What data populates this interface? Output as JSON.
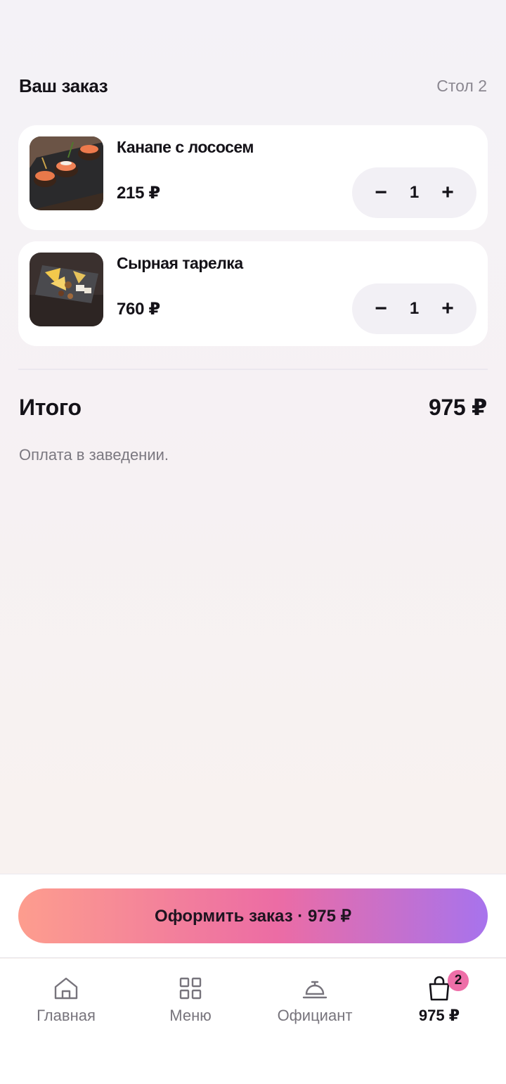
{
  "header": {
    "title": "Ваш заказ",
    "table": "Стол 2"
  },
  "items": [
    {
      "name": "Канапе с лососем",
      "price": "215 ₽",
      "qty": "1",
      "image": "salmon-canape-photo"
    },
    {
      "name": "Сырная тарелка",
      "price": "760 ₽",
      "qty": "1",
      "image": "cheese-plate-photo"
    }
  ],
  "stepper": {
    "minus": "−",
    "plus": "+"
  },
  "summary": {
    "label": "Итого",
    "total": "975 ₽",
    "note": "Оплата в заведении."
  },
  "checkout": {
    "label": "Оформить заказ · 975 ₽"
  },
  "nav": {
    "home": "Главная",
    "menu": "Меню",
    "waiter": "Официант",
    "cart": "975 ₽",
    "cart_badge": "2"
  },
  "colors": {
    "accent_start": "#fd9d8e",
    "accent_mid": "#ec6ca4",
    "accent_end": "#a773ed",
    "badge": "#ee6fa8"
  }
}
